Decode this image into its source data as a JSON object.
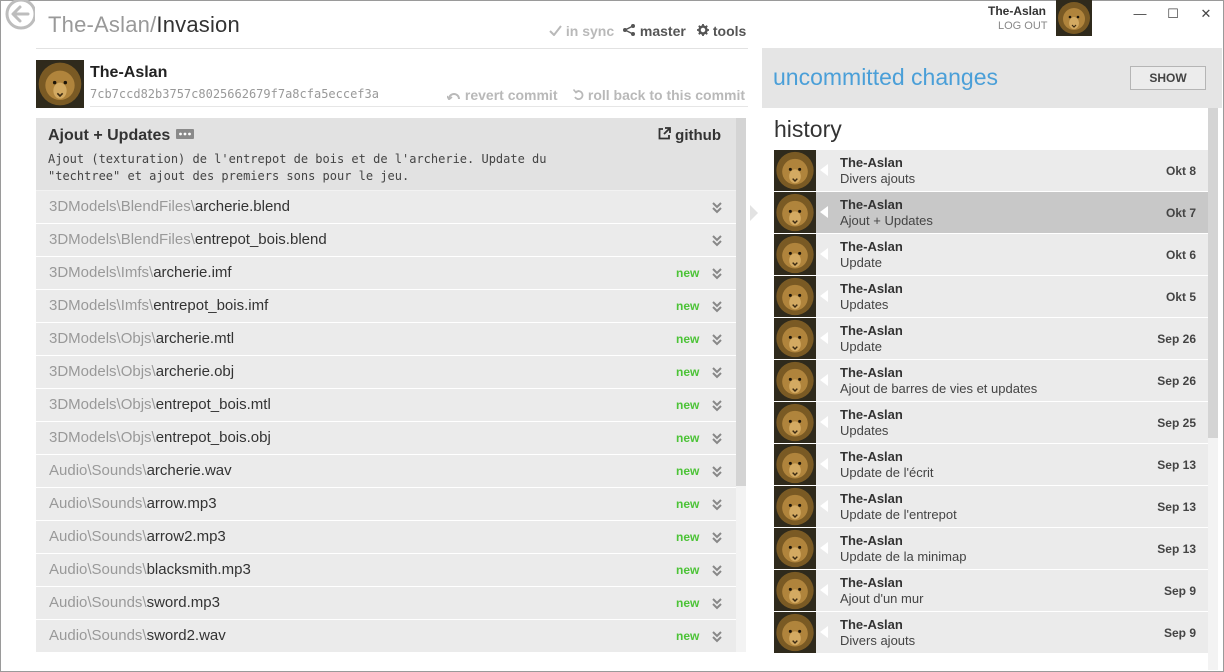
{
  "window": {
    "minimize": "—",
    "maximize": "☐",
    "close": "✕"
  },
  "header": {
    "owner": "The-Aslan/",
    "repo": "Invasion",
    "sync": "in sync",
    "branch": "master",
    "tools": "tools"
  },
  "user": {
    "name": "The-Aslan",
    "logout": "LOG OUT"
  },
  "commit": {
    "author": "The-Aslan",
    "sha": "7cb7ccd82b3757c8025662679f7a8cfa5eccef3a",
    "revert": "revert commit",
    "rollback": "roll back to this commit",
    "title": "Ajout + Updates",
    "body": "Ajout (texturation) de l'entrepot de bois et de l'archerie. Update du\n\"techtree\" et ajout des premiers sons pour le jeu.",
    "github": "github"
  },
  "files": [
    {
      "dir": "3DModels\\BlendFiles\\",
      "name": "archerie.blend",
      "badge": ""
    },
    {
      "dir": "3DModels\\BlendFiles\\",
      "name": "entrepot_bois.blend",
      "badge": ""
    },
    {
      "dir": "3DModels\\Imfs\\",
      "name": "archerie.imf",
      "badge": "new"
    },
    {
      "dir": "3DModels\\Imfs\\",
      "name": "entrepot_bois.imf",
      "badge": "new"
    },
    {
      "dir": "3DModels\\Objs\\",
      "name": "archerie.mtl",
      "badge": "new"
    },
    {
      "dir": "3DModels\\Objs\\",
      "name": "archerie.obj",
      "badge": "new"
    },
    {
      "dir": "3DModels\\Objs\\",
      "name": "entrepot_bois.mtl",
      "badge": "new"
    },
    {
      "dir": "3DModels\\Objs\\",
      "name": "entrepot_bois.obj",
      "badge": "new"
    },
    {
      "dir": "Audio\\Sounds\\",
      "name": "archerie.wav",
      "badge": "new"
    },
    {
      "dir": "Audio\\Sounds\\",
      "name": "arrow.mp3",
      "badge": "new"
    },
    {
      "dir": "Audio\\Sounds\\",
      "name": "arrow2.mp3",
      "badge": "new"
    },
    {
      "dir": "Audio\\Sounds\\",
      "name": "blacksmith.mp3",
      "badge": "new"
    },
    {
      "dir": "Audio\\Sounds\\",
      "name": "sword.mp3",
      "badge": "new"
    },
    {
      "dir": "Audio\\Sounds\\",
      "name": "sword2.wav",
      "badge": "new"
    }
  ],
  "uncommitted": {
    "title": "uncommitted changes",
    "show": "SHOW"
  },
  "history": {
    "title": "history",
    "items": [
      {
        "author": "The-Aslan",
        "message": "Divers ajouts",
        "date": "Okt 8",
        "selected": false
      },
      {
        "author": "The-Aslan",
        "message": "Ajout + Updates",
        "date": "Okt 7",
        "selected": true
      },
      {
        "author": "The-Aslan",
        "message": "Update",
        "date": "Okt 6",
        "selected": false
      },
      {
        "author": "The-Aslan",
        "message": "Updates",
        "date": "Okt 5",
        "selected": false
      },
      {
        "author": "The-Aslan",
        "message": "Update",
        "date": "Sep 26",
        "selected": false
      },
      {
        "author": "The-Aslan",
        "message": "Ajout de barres de vies et updates",
        "date": "Sep 26",
        "selected": false
      },
      {
        "author": "The-Aslan",
        "message": "Updates",
        "date": "Sep 25",
        "selected": false
      },
      {
        "author": "The-Aslan",
        "message": "Update de l'écrit",
        "date": "Sep 13",
        "selected": false
      },
      {
        "author": "The-Aslan",
        "message": "Update de l'entrepot",
        "date": "Sep 13",
        "selected": false
      },
      {
        "author": "The-Aslan",
        "message": "Update de la minimap",
        "date": "Sep 13",
        "selected": false
      },
      {
        "author": "The-Aslan",
        "message": "Ajout d'un mur",
        "date": "Sep 9",
        "selected": false
      },
      {
        "author": "The-Aslan",
        "message": "Divers ajouts",
        "date": "Sep 9",
        "selected": false
      }
    ]
  },
  "colors": {
    "accent": "#4a9fd8",
    "new_badge": "#4cc337",
    "selected_row": "#c8c8c8"
  },
  "icons": {
    "back": "back-arrow-icon",
    "sync": "check-icon",
    "branch": "branch-icon",
    "tools": "gear-icon",
    "revert": "revert-icon",
    "rollback": "undo-icon",
    "github": "external-link-icon",
    "expand": "double-chevron-down-icon",
    "avatar": "lion-avatar"
  }
}
